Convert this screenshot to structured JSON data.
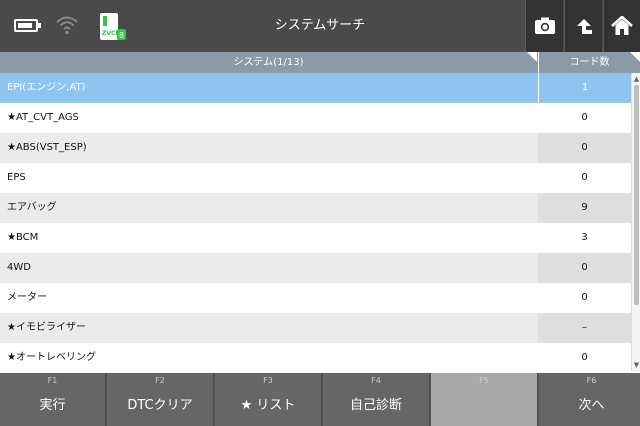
{
  "header": {
    "title": "システムサーチ",
    "battery_level": 0.85,
    "vci_label": "ZVCI",
    "vci_indicator": "8",
    "icons": [
      "battery-icon",
      "wifi-icon",
      "vci-device-icon",
      "camera-icon",
      "upload-icon",
      "home-icon"
    ]
  },
  "table": {
    "col_system": "システム(1/13)",
    "col_count": "コード数",
    "rows": [
      {
        "name": "EPI(エンジン,AT)",
        "count": "1",
        "selected": true
      },
      {
        "name": "★AT_CVT_AGS",
        "count": "0"
      },
      {
        "name": "★ABS(VST_ESP)",
        "count": "0"
      },
      {
        "name": "EPS",
        "count": "0"
      },
      {
        "name": "エアバッグ",
        "count": "9"
      },
      {
        "name": "★BCM",
        "count": "3"
      },
      {
        "name": "4WD",
        "count": "0"
      },
      {
        "name": "メーター",
        "count": "0"
      },
      {
        "name": "★イモビライザー",
        "count": "–"
      },
      {
        "name": "★オートレベリング",
        "count": "0"
      }
    ]
  },
  "fkeys": [
    {
      "fn": "F1",
      "label": "実行"
    },
    {
      "fn": "F2",
      "label": "DTCクリア"
    },
    {
      "fn": "F3",
      "label": "★ リスト"
    },
    {
      "fn": "F4",
      "label": "自己診断"
    },
    {
      "fn": "F5",
      "label": ""
    },
    {
      "fn": "F6",
      "label": "次へ"
    }
  ],
  "colors": {
    "topbar": "#4a4a4a",
    "table_header": "#8c9aa8",
    "selected_row": "#8ec4ef",
    "vci_green": "#2ecc40"
  }
}
